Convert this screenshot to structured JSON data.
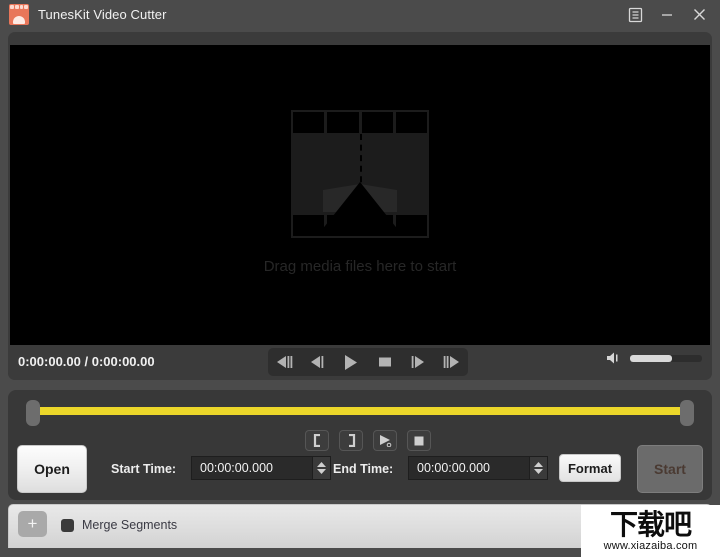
{
  "window": {
    "title": "TunesKit Video Cutter",
    "app_icon": "film-strip-icon",
    "controls": {
      "menu": "menu-icon",
      "minimize": "minimize-icon",
      "close": "close-icon"
    }
  },
  "player": {
    "dropzone_icon": "media-placeholder-icon",
    "dropzone_text": "Drag media files here to start",
    "time_display": "0:00:00.00 / 0:00:00.00",
    "transport": [
      {
        "name": "step-back-fast-button",
        "glyph": "prev-fast"
      },
      {
        "name": "step-back-button",
        "glyph": "prev"
      },
      {
        "name": "play-button",
        "glyph": "play"
      },
      {
        "name": "stop-button",
        "glyph": "stop"
      },
      {
        "name": "step-forward-button",
        "glyph": "next"
      },
      {
        "name": "step-forward-fast-button",
        "glyph": "next-fast"
      }
    ],
    "volume": {
      "icon": "volume-icon",
      "level_percent": 58
    }
  },
  "editor": {
    "trim_bar": {
      "track_color": "#ecd72a",
      "left_handle": "trim-start-handle",
      "right_handle": "trim-end-handle"
    },
    "cut_buttons": [
      {
        "name": "set-start-point-button",
        "glyph": "["
      },
      {
        "name": "set-end-point-button",
        "glyph": "]"
      },
      {
        "name": "preview-segment-button",
        "glyph": "play"
      },
      {
        "name": "stop-preview-button",
        "glyph": "stop"
      }
    ],
    "open_label": "Open",
    "start_time_label": "Start Time:",
    "start_time_value": "00:00:00.000",
    "end_time_label": "End Time:",
    "end_time_value": "00:00:00.000",
    "format_label": "Format",
    "start_label": "Start"
  },
  "segments": {
    "add_label": "+",
    "merge_checkbox_label": "Merge Segments",
    "merge_checked": false
  },
  "watermark": {
    "brand": "下载吧",
    "url": "www.xiazaiba.com"
  }
}
